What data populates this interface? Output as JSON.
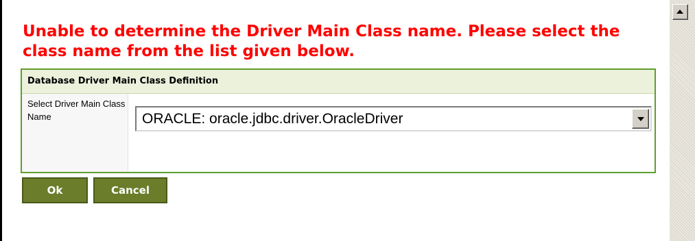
{
  "error": {
    "message": "Unable to determine the Driver Main Class name. Please select the class name from the list given below."
  },
  "panel": {
    "header": "Database Driver Main Class Definition",
    "field_label": "Select Driver Main Class Name",
    "select": {
      "value": "ORACLE: oracle.jdbc.driver.OracleDriver"
    }
  },
  "buttons": {
    "ok": "Ok",
    "cancel": "Cancel"
  },
  "colors": {
    "error_text": "#ff0000",
    "panel_border": "#5f9d2b",
    "header_bg": "#ecf1dc",
    "button_bg": "#6b7d2a"
  },
  "icons": {
    "dropdown": "chevron-down-icon",
    "scroll_up": "arrow-up-icon"
  }
}
